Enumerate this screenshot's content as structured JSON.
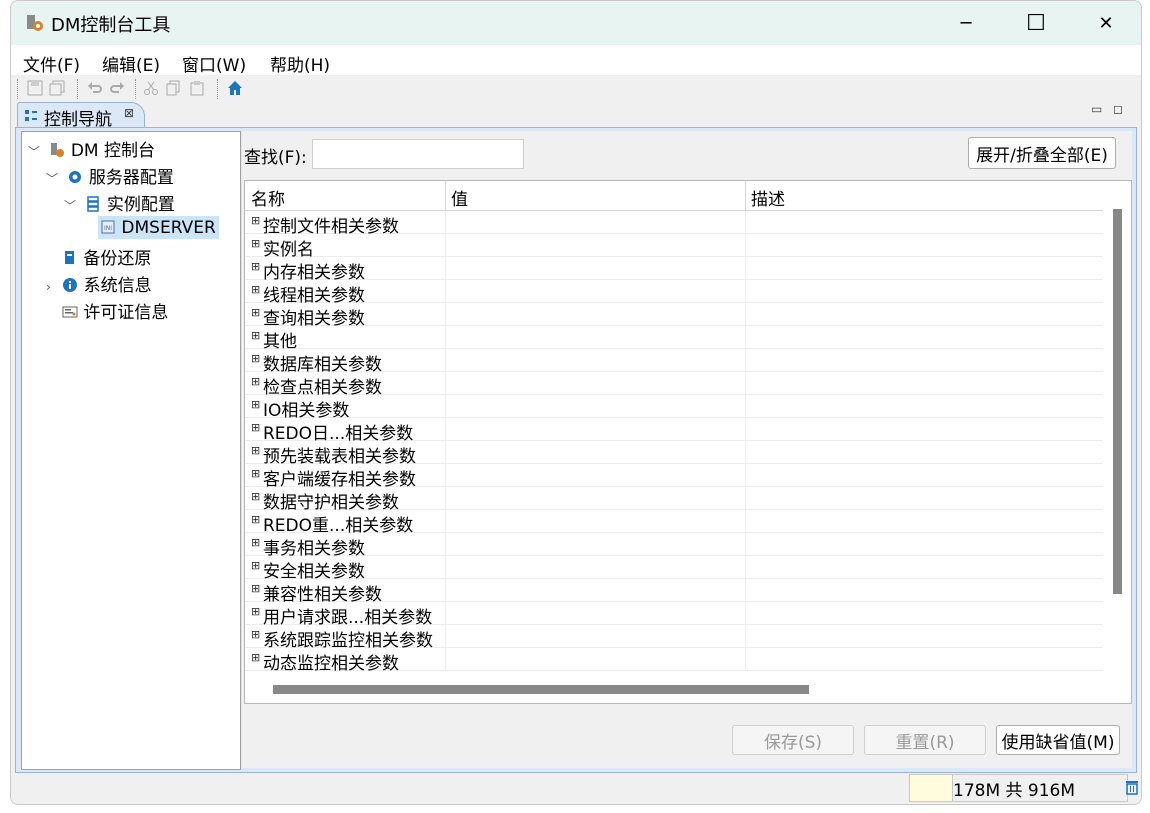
{
  "window": {
    "title": "DM控制台工具",
    "minimize_glyph": "─",
    "maximize_glyph": "☐",
    "close_glyph": "✕"
  },
  "menu": [
    {
      "label": "文件(F)"
    },
    {
      "label": "编辑(E)"
    },
    {
      "label": "窗口(W)"
    },
    {
      "label": "帮助(H)"
    }
  ],
  "toolbar": {
    "icons": [
      "save-icon",
      "save-all-icon",
      "undo-icon",
      "redo-icon",
      "cut-icon",
      "copy-icon",
      "paste-icon",
      "home-icon"
    ]
  },
  "tab": {
    "label": "控制导航",
    "close_glyph": "⊠"
  },
  "tree": {
    "root": "DM 控制台",
    "server_config": "服务器配置",
    "instance_config": "实例配置",
    "dmserver": "DMSERVER",
    "backup": "备份还原",
    "system_info": "系统信息",
    "license": "许可证信息"
  },
  "search": {
    "label": "查找(F):",
    "value": ""
  },
  "expand_button": "展开/折叠全部(E)",
  "table": {
    "headers": [
      "名称",
      "值",
      "描述"
    ],
    "rows": [
      "控制文件相关参数",
      "实例名",
      "内存相关参数",
      "线程相关参数",
      "查询相关参数",
      "其他",
      "数据库相关参数",
      "检查点相关参数",
      "IO相关参数",
      "REDO日...相关参数",
      "预先装载表相关参数",
      "客户端缓存相关参数",
      "数据守护相关参数",
      "REDO重...相关参数",
      "事务相关参数",
      "安全相关参数",
      "兼容性相关参数",
      "用户请求跟...相关参数",
      "系统跟踪监控相关参数",
      "动态监控相关参数"
    ],
    "expand_glyph": "⊞"
  },
  "buttons": {
    "save": "保存(S)",
    "reset": "重置(R)",
    "defaults": "使用缺省值(M)"
  },
  "status": {
    "memory": "178M 共 916M"
  },
  "colors": {
    "accent_blue": "#1e73be",
    "selection": "#cce4f7",
    "panel_bg": "#dce7f7"
  }
}
